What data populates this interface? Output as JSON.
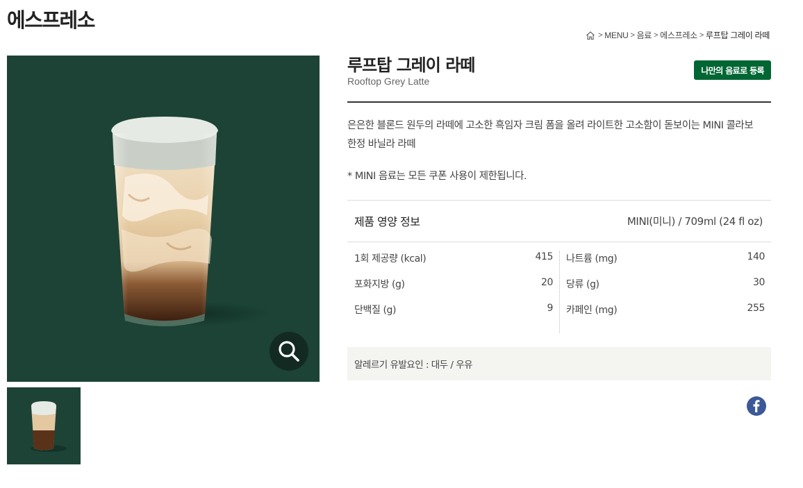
{
  "page": {
    "title": "에스프레소"
  },
  "breadcrumb": {
    "items": [
      "MENU",
      "음료",
      "에스프레소"
    ],
    "current": "루프탑 그레이 라떼",
    "separator": ">"
  },
  "product": {
    "name_ko": "루프탑 그레이 라떼",
    "name_en": "Rooftop Grey Latte",
    "favorite_label": "나만의 음료로 등록",
    "description": "은은한 블론드 원두의 라떼에 고소한 흑임자 크림 폼을 올려 라이트한 고소함이 돋보이는 MINI 콜라보 한정 바닐라 라떼",
    "note": "* MINI 음료는 모든 쿠폰 사용이 제한됩니다."
  },
  "nutrition": {
    "title": "제품 영양 정보",
    "size": "MINI(미니)  / 709ml (24 fl oz)",
    "left": [
      {
        "label": "1회 제공량 (kcal)",
        "value": "415"
      },
      {
        "label": "포화지방 (g)",
        "value": "20"
      },
      {
        "label": "단백질 (g)",
        "value": "9"
      }
    ],
    "right": [
      {
        "label": "나트륨 (mg)",
        "value": "140"
      },
      {
        "label": "당류 (g)",
        "value": "30"
      },
      {
        "label": "카페인 (mg)",
        "value": "255"
      }
    ]
  },
  "allergy": {
    "text": "알레르기 유발요인 : 대두 / 우유"
  },
  "colors": {
    "brand_green": "#006633",
    "image_bg": "#1c4336",
    "facebook_blue": "#3b5998"
  },
  "icons": {
    "home": "home-icon",
    "zoom": "magnifier-icon",
    "share": "facebook-icon"
  }
}
